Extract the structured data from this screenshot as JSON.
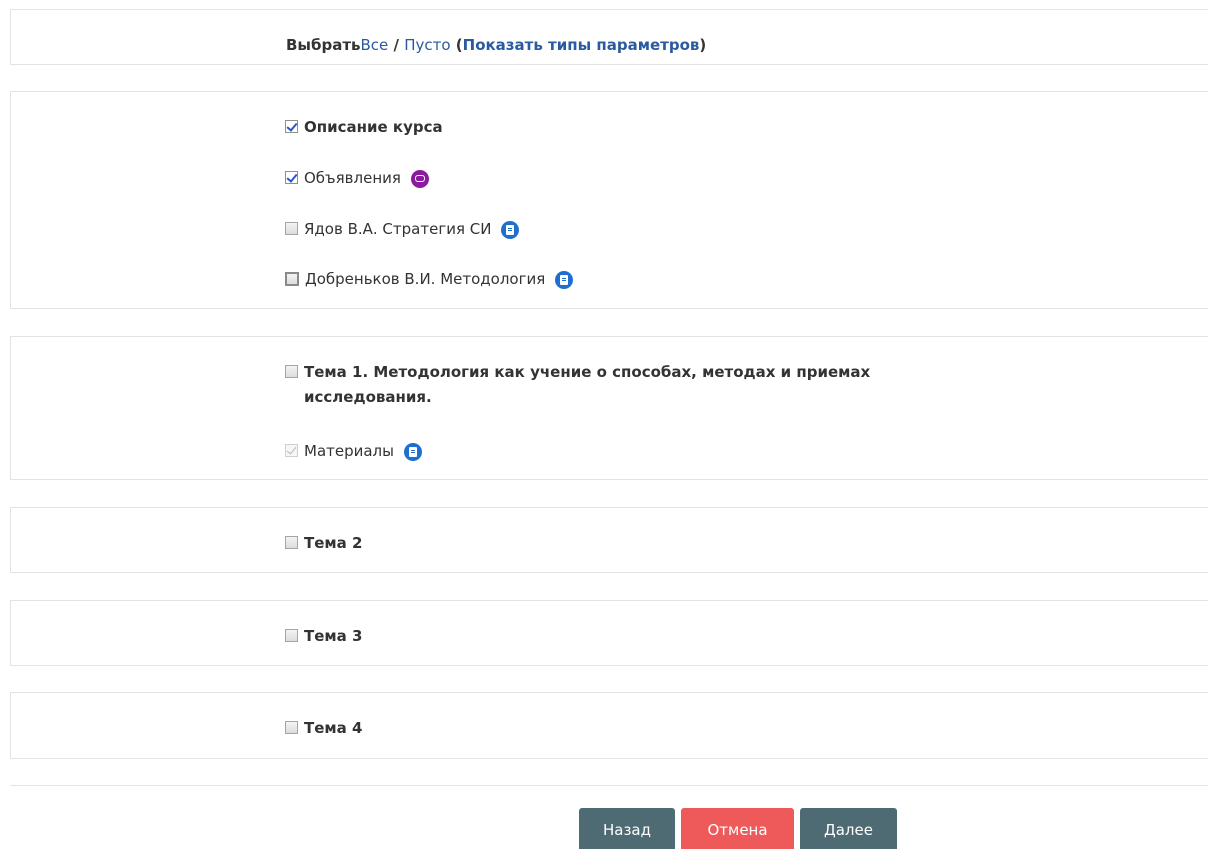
{
  "select_bar": {
    "label": "Выбрать",
    "all": "Все",
    "separator": " / ",
    "none": "Пусто",
    "paren_open": " (",
    "show_types": "Показать типы параметров",
    "paren_close": ")"
  },
  "sections": [
    {
      "items": [
        {
          "label": "Описание курса",
          "checked": true,
          "bold": true,
          "icon": ""
        },
        {
          "label": "Объявления",
          "checked": true,
          "bold": false,
          "icon": "forum-icon"
        },
        {
          "label": "Ядов В.А. Стратегия СИ",
          "checked": false,
          "bold": false,
          "icon": "resource-icon"
        },
        {
          "label": "Добреньков В.И. Методология",
          "checked": false,
          "bold": false,
          "icon": "resource-icon"
        }
      ]
    },
    {
      "items": [
        {
          "label_line1": "Тема 1. Методология как учение о способах, методах и приемах",
          "label_line2": "исследования.",
          "checked": false,
          "bold": true
        },
        {
          "label": "Материалы",
          "checked": true,
          "disabled": true,
          "bold": false,
          "icon": "resource-icon"
        }
      ]
    },
    {
      "items": [
        {
          "label": "Тема 2",
          "checked": false,
          "bold": true
        }
      ]
    },
    {
      "items": [
        {
          "label": "Тема 3",
          "checked": false,
          "bold": true
        }
      ]
    },
    {
      "items": [
        {
          "label": "Тема 4",
          "checked": false,
          "bold": true
        }
      ]
    }
  ],
  "buttons": {
    "back": "Назад",
    "cancel": "Отмена",
    "next": "Далее"
  },
  "colors": {
    "forum_icon": "#8c1aa1",
    "resource_icon": "#1e6fd0",
    "link": "#2a5aa0",
    "button_dark": "#4e6a73",
    "button_cancel": "#ee5a5a"
  }
}
